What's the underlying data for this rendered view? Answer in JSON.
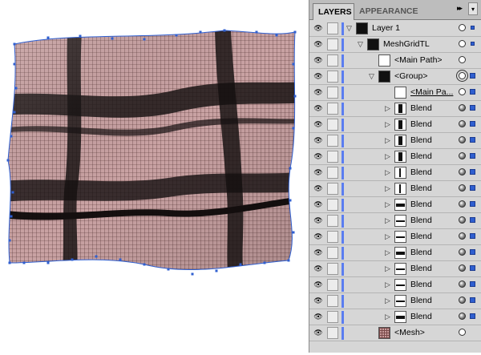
{
  "panel": {
    "tabs": [
      "LAYERS",
      "APPEARANCE"
    ],
    "menu_arrows": "▸▸",
    "menu_button": "▾",
    "rows": [
      {
        "label": "Layer 1",
        "thumb": "black",
        "indent": 0,
        "expand": "down",
        "target": "plain",
        "sel": "small"
      },
      {
        "label": "MeshGridTL",
        "thumb": "black",
        "indent": 1,
        "expand": "down",
        "target": "plain",
        "sel": "small"
      },
      {
        "label": "<Main Path>",
        "thumb": "white",
        "indent": 2,
        "expand": "none",
        "target": "plain",
        "sel": "none"
      },
      {
        "label": "<Group>",
        "thumb": "black",
        "indent": 2,
        "expand": "down",
        "target": "double",
        "sel": "big"
      },
      {
        "label": "<Main Pa...",
        "thumb": "white",
        "indent": 3,
        "expand": "none",
        "target": "plain",
        "sel": "big",
        "underline": true
      },
      {
        "label": "Blend",
        "thumb": "vbar",
        "indent": 3,
        "expand": "right",
        "target": "filled",
        "sel": "big"
      },
      {
        "label": "Blend",
        "thumb": "vbar",
        "indent": 3,
        "expand": "right",
        "target": "filled",
        "sel": "big"
      },
      {
        "label": "Blend",
        "thumb": "vbar",
        "indent": 3,
        "expand": "right",
        "target": "filled",
        "sel": "big"
      },
      {
        "label": "Blend",
        "thumb": "vbar",
        "indent": 3,
        "expand": "right",
        "target": "filled",
        "sel": "big"
      },
      {
        "label": "Blend",
        "thumb": "vline",
        "indent": 3,
        "expand": "right",
        "target": "filled",
        "sel": "big"
      },
      {
        "label": "Blend",
        "thumb": "vline",
        "indent": 3,
        "expand": "right",
        "target": "filled",
        "sel": "big"
      },
      {
        "label": "Blend",
        "thumb": "hbar",
        "indent": 3,
        "expand": "right",
        "target": "filled",
        "sel": "big"
      },
      {
        "label": "Blend",
        "thumb": "hline",
        "indent": 3,
        "expand": "right",
        "target": "filled",
        "sel": "big"
      },
      {
        "label": "Blend",
        "thumb": "hline",
        "indent": 3,
        "expand": "right",
        "target": "filled",
        "sel": "big"
      },
      {
        "label": "Blend",
        "thumb": "hbar",
        "indent": 3,
        "expand": "right",
        "target": "filled",
        "sel": "big"
      },
      {
        "label": "Blend",
        "thumb": "hline",
        "indent": 3,
        "expand": "right",
        "target": "filled",
        "sel": "big"
      },
      {
        "label": "Blend",
        "thumb": "hline",
        "indent": 3,
        "expand": "right",
        "target": "filled",
        "sel": "big"
      },
      {
        "label": "Blend",
        "thumb": "hline",
        "indent": 3,
        "expand": "right",
        "target": "filled",
        "sel": "big"
      },
      {
        "label": "Blend",
        "thumb": "hbar",
        "indent": 3,
        "expand": "right",
        "target": "filled",
        "sel": "big"
      },
      {
        "label": "<Mesh>",
        "thumb": "mesh",
        "indent": 2,
        "expand": "none",
        "target": "plain",
        "sel": "none"
      }
    ]
  },
  "colors": {
    "layer_color": "#5b7df0",
    "mesh_fill": "#c79c9c",
    "mesh_line": "#3a1f1f",
    "anchor": "#2f5fd0"
  }
}
